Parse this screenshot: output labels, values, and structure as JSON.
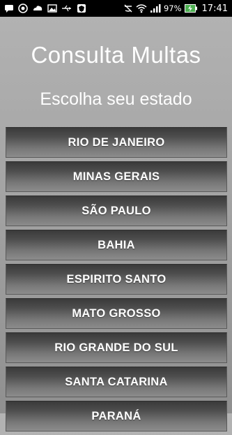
{
  "status_bar": {
    "battery_percent": "97%",
    "time": "17:41",
    "icons": [
      "chat-icon",
      "whatsapp-icon",
      "cloud-icon",
      "image-icon",
      "usb-icon",
      "shield-icon",
      "mute-icon",
      "wifi-icon",
      "signal-icon",
      "battery-charging-icon"
    ]
  },
  "app": {
    "title": "Consulta Multas",
    "subtitle": "Escolha seu estado"
  },
  "states": [
    {
      "label": "RIO DE JANEIRO"
    },
    {
      "label": "MINAS GERAIS"
    },
    {
      "label": "SÃO PAULO"
    },
    {
      "label": "BAHIA"
    },
    {
      "label": "ESPIRITO SANTO"
    },
    {
      "label": "MATO GROSSO"
    },
    {
      "label": "RIO GRANDE DO SUL"
    },
    {
      "label": "SANTA CATARINA"
    },
    {
      "label": "PARANÁ"
    }
  ],
  "colors": {
    "background_top": "#b3b3b3",
    "background_bottom": "#8f8f8f",
    "button_dark": "#3a3a3a",
    "button_light": "#8c8c8c",
    "battery_green": "#4caf50"
  }
}
